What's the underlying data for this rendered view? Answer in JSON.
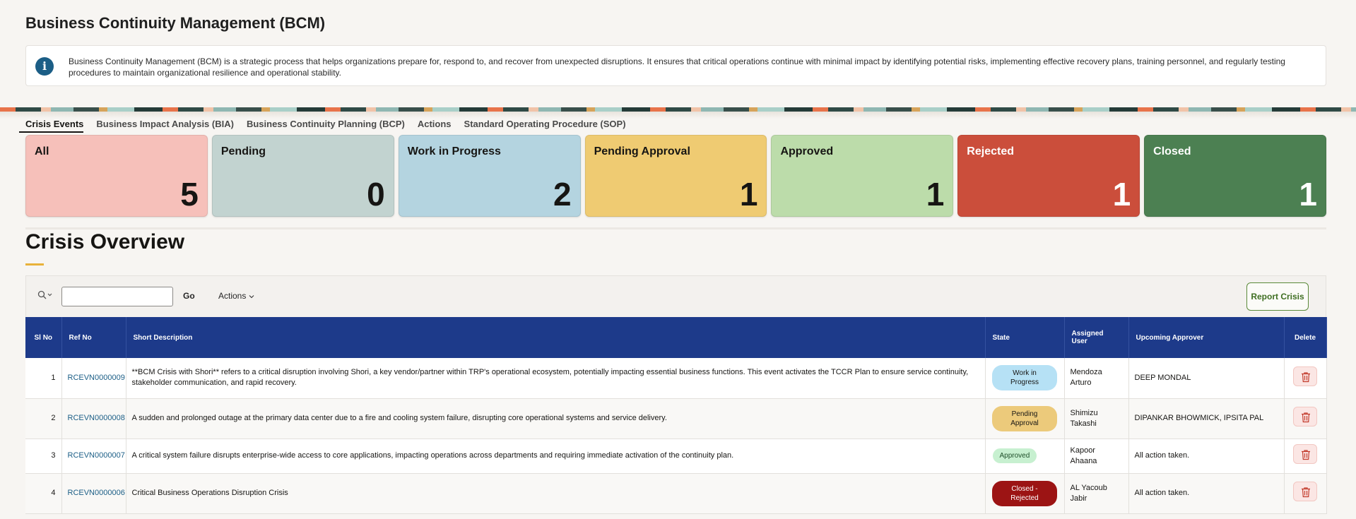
{
  "page": {
    "title": "Business Continuity Management (BCM)",
    "info_text": "Business Continuity Management (BCM) is a strategic process that helps organizations prepare for, respond to, and recover from unexpected disruptions. It ensures that critical operations continue with minimal impact by identifying potential risks, implementing effective recovery plans, training personnel, and regularly testing procedures to maintain organizational resilience and operational stability."
  },
  "tabs": [
    {
      "label": "Crisis Events",
      "active": true
    },
    {
      "label": "Business Impact Analysis (BIA)"
    },
    {
      "label": "Business Continuity Planning (BCP)"
    },
    {
      "label": "Actions"
    },
    {
      "label": "Standard Operating Procedure (SOP)"
    }
  ],
  "cards": [
    {
      "label": "All",
      "count": "5",
      "bg": "#f6c0ba",
      "fg": "#161513"
    },
    {
      "label": "Pending",
      "count": "0",
      "bg": "#c2d3d0",
      "fg": "#161513"
    },
    {
      "label": "Work in Progress",
      "count": "2",
      "bg": "#b4d4e0",
      "fg": "#161513"
    },
    {
      "label": "Pending Approval",
      "count": "1",
      "bg": "#efcb72",
      "fg": "#161513"
    },
    {
      "label": "Approved",
      "count": "1",
      "bg": "#bcdcaa",
      "fg": "#161513"
    },
    {
      "label": "Rejected",
      "count": "1",
      "bg": "#cb4e3b",
      "fg": "#ffffff"
    },
    {
      "label": "Closed",
      "count": "1",
      "bg": "#4c8052",
      "fg": "#ffffff"
    }
  ],
  "overview": {
    "title": "Crisis Overview",
    "search_placeholder": "",
    "go_label": "Go",
    "actions_label": "Actions",
    "report_label": "Report Crisis"
  },
  "table": {
    "headers": {
      "sl_no": "Sl No",
      "ref_no": "Ref No",
      "short_description": "Short Description",
      "state": "State",
      "assigned_user": "Assigned User",
      "upcoming_approver": "Upcoming Approver",
      "delete": "Delete"
    },
    "rows": [
      {
        "sl": "1",
        "ref": "RCEVN0000009",
        "desc": "**BCM Crisis with Shori** refers to a critical disruption involving Shori, a key vendor/partner within TRP's operational ecosystem, potentially impacting essential business functions. This event activates the TCCR Plan to ensure service continuity, stakeholder communication, and rapid recovery.",
        "state": "Work in Progress",
        "state_bg": "#b6e1f5",
        "state_fg": "#161513",
        "user": "Mendoza Arturo",
        "approver": "DEEP MONDAL"
      },
      {
        "sl": "2",
        "ref": "RCEVN0000008",
        "desc": "A sudden and prolonged outage at the primary data center due to a fire and cooling system failure, disrupting core operational systems and service delivery.",
        "state": "Pending Approval",
        "state_bg": "#ecca7b",
        "state_fg": "#161513",
        "user": "Shimizu Takashi",
        "approver": "DIPANKAR BHOWMICK, IPSITA PAL"
      },
      {
        "sl": "3",
        "ref": "RCEVN0000007",
        "desc": "A critical system failure disrupts enterprise-wide access to core applications, impacting operations across departments and requiring immediate activation of the continuity plan.",
        "state": "Approved",
        "state_bg": "#c7f0d0",
        "state_fg": "#1f4f2a",
        "user": "Kapoor Ahaana",
        "approver": "All action taken."
      },
      {
        "sl": "4",
        "ref": "RCEVN0000006",
        "desc": "Critical Business Operations Disruption Crisis",
        "state": "Closed - Rejected",
        "state_bg": "#9c1414",
        "state_fg": "#ffffff",
        "user": "AL Yacoub Jabir",
        "approver": "All action taken."
      }
    ]
  },
  "colors": {
    "header_bg": "#1d3a8a",
    "accent": "#e8b23a",
    "link": "#1b5e86"
  }
}
